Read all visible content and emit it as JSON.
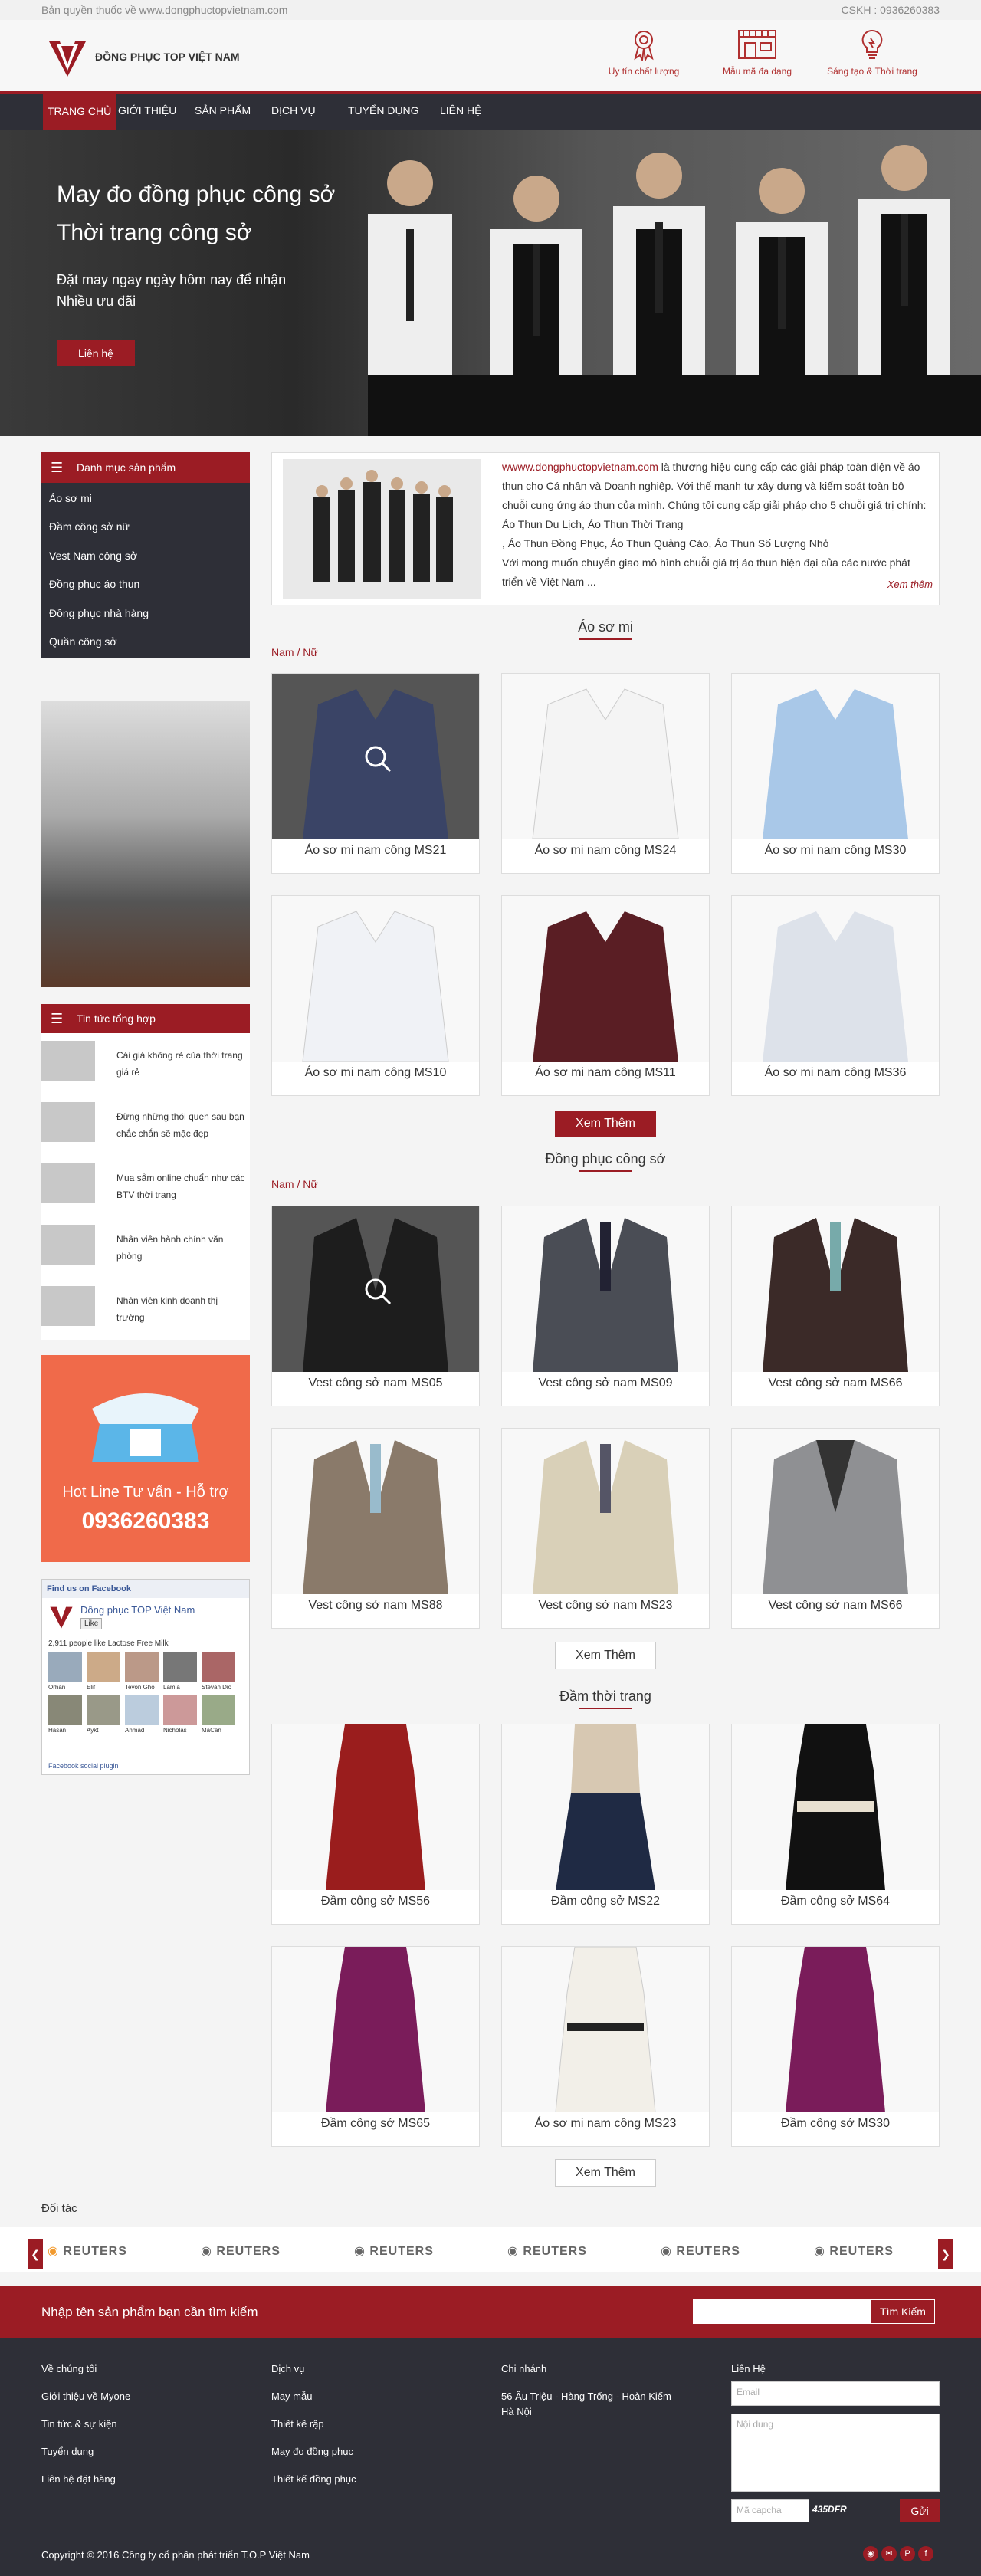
{
  "topbar": {
    "copyright": "Bản quyền thuốc về www.dongphuctopvietnam.com",
    "hotline": "CSKH : 0936260383"
  },
  "header": {
    "brand": "ĐỒNG PHỤC TOP VIỆT NAM",
    "features": [
      {
        "label": "Uy tín chất lượng",
        "icon": "medal-icon"
      },
      {
        "label": "Mẫu mã đa dạng",
        "icon": "store-icon"
      },
      {
        "label": "Sáng tạo & Thời trang",
        "icon": "lightbulb-icon"
      }
    ]
  },
  "nav": [
    "TRANG CHỦ",
    "GIỚI THIỆU",
    "SẢN PHẨM",
    "DỊCH VỤ",
    "TUYỂN DỤNG",
    "LIÊN HỆ"
  ],
  "hero": {
    "line1": "May đo đồng phục công sở",
    "line2": "Thời trang công sở",
    "sub1": "Đặt may ngay ngày hôm nay để nhận",
    "sub2": "Nhiều ưu đãi",
    "button": "Liên hệ"
  },
  "sidebar": {
    "category_title": "Danh mục sản phẩm",
    "categories": [
      "Áo sơ mi",
      "Đầm công sở nữ",
      "Vest Nam công sở",
      "Đồng phục áo thun",
      "Đồng phục nhà hàng",
      "Quần công sở"
    ],
    "news_title": "Tin tức tổng hợp",
    "news": [
      "Cái giá không rẻ của thời trang giá rẻ",
      "Đừng những thói quen sau bạn chắc chắn sẽ mặc đẹp",
      "Mua sắm online chuẩn như các BTV thời trang",
      "Nhân viên hành chính văn phòng",
      "Nhân viên kinh doanh thị trường"
    ],
    "hotline_title": "Hot Line Tư vấn - Hỗ trợ",
    "hotline_number": "0936260383",
    "fb_head": "Find us on Facebook",
    "fb_page": "Đồng phục TOP Việt Nam",
    "fb_like": "Like",
    "fb_count": "2,911 people like Lactose Free Milk",
    "fb_people": [
      "Orhan",
      "Elif",
      "Tevon Gho",
      "Lamia",
      "Stevan Dio",
      "Hasan",
      "Aykt",
      "Ahmad",
      "Nicholas",
      "MaCan"
    ],
    "fb_plugin": "Facebook social plugin"
  },
  "intro": {
    "link": "wwww.dongphuctopvietnam.com",
    "text": " là thương hiệu cung cấp các giải pháp toàn diện về áo thun cho Cá nhân và Doanh nghiệp. Với thế mạnh tự xây dựng và kiểm soát toàn bộ chuỗi cung ứng áo thun của mình. Chúng tôi cung cấp giải pháp cho 5 chuỗi giá trị chính: Áo Thun Du Lịch, Áo Thun Thời Trang",
    "text2": ", Áo Thun Đồng Phục, Áo Thun Quảng Cáo, Áo Thun Số Lượng Nhỏ",
    "text3": "Với mong muốn chuyển giao mô hình chuỗi giá trị áo thun hiện đại của các nước phát triển về Việt Nam ...",
    "more": "Xem thêm"
  },
  "sections": [
    {
      "title": "Áo sơ mi",
      "crumb": "Nam / Nữ",
      "items": [
        "Áo sơ mi nam công MS21",
        "Áo sơ mi nam công MS24",
        "Áo sơ mi nam công MS30",
        "Áo sơ mi nam công MS10",
        "Áo sơ mi nam công MS11",
        "Áo sơ mi nam công MS36"
      ],
      "button": "Xem Thêm"
    },
    {
      "title": "Đồng phục công sở",
      "crumb": "Nam / Nữ",
      "items": [
        "Vest công sở nam MS05",
        "Vest công sở nam MS09",
        "Vest công sở nam MS66",
        "Vest công sở nam MS88",
        "Vest công sở nam MS23",
        "Vest công sở nam MS66"
      ],
      "button": "Xem Thêm"
    },
    {
      "title": "Đầm thời trang",
      "crumb": "",
      "items": [
        "Đầm công sở MS56",
        "Đầm công sở MS22",
        "Đầm công sở MS64",
        "Đầm công sở MS65",
        "Áo sơ mi nam công MS23",
        "Đầm công sở MS30"
      ],
      "button": "Xem Thêm"
    }
  ],
  "partners": {
    "title": "Đối tác",
    "name": "REUTERS"
  },
  "search": {
    "label": "Nhập tên sản phẩm bạn cần tìm kiếm",
    "button": "Tìm Kiếm"
  },
  "footer": {
    "col1": [
      "Về chúng tôi",
      "Giới thiệu về Myone",
      "Tin tức & sự kiện",
      "Tuyển dụng",
      "Liên hệ đặt hàng"
    ],
    "col2": [
      "Dịch vụ",
      "May mẫu",
      "Thiết kế rập",
      "May đo đồng phục",
      "Thiết kế đồng phục"
    ],
    "col3": [
      "Chi nhánh",
      "56 Âu Triệu - Hàng Trống - Hoàn Kiếm",
      "Hà Nội"
    ],
    "contact_title": "Liên Hệ",
    "email_ph": "Email",
    "content_ph": "Nội dung",
    "captcha_ph": "Mã capcha",
    "captcha_code": "435DFR",
    "send": "Gửi",
    "copyright": "Copyright © 2016 Công ty cổ phần phát triển T.O.P Việt Nam"
  },
  "colors": {
    "brand": "#9b1c24",
    "dark": "#2e2f37"
  }
}
